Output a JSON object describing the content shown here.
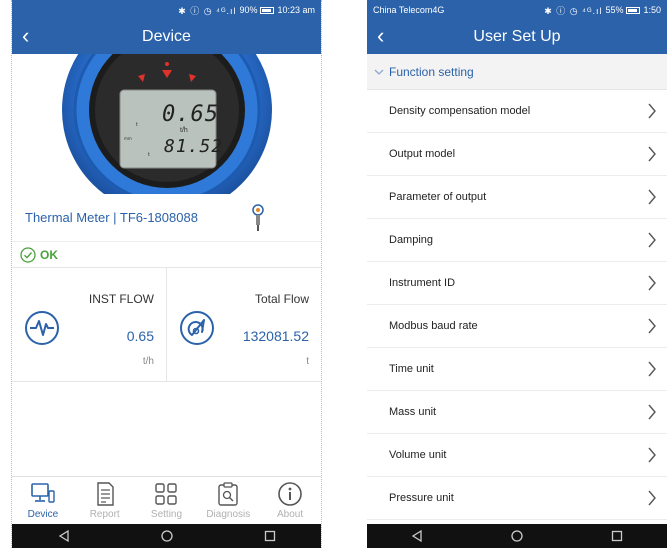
{
  "left": {
    "status": {
      "carrier": "",
      "icons": "✱ ⓘ ◷ ⁴ᴳ.ıl",
      "battery": "90%",
      "time": "10:23 am"
    },
    "header": {
      "title": "Device"
    },
    "display": {
      "primary": "0.65",
      "unit": "t/h",
      "secondary": "81.52"
    },
    "meter": {
      "name": "Thermal Meter  |  TF6-1808088"
    },
    "status_text": "OK",
    "inst_flow": {
      "label": "INST FLOW",
      "value": "0.65",
      "unit": "t/h"
    },
    "total_flow": {
      "label": "Total Flow",
      "value": "132081.52",
      "unit": "t"
    },
    "tabs": [
      {
        "label": "Device",
        "icon": "monitor-icon",
        "active": true
      },
      {
        "label": "Report",
        "icon": "document-icon",
        "active": false
      },
      {
        "label": "Setting",
        "icon": "grid-icon",
        "active": false
      },
      {
        "label": "Diagnosis",
        "icon": "clipboard-search-icon",
        "active": false
      },
      {
        "label": "About",
        "icon": "info-icon",
        "active": false
      }
    ]
  },
  "right": {
    "status": {
      "carrier": "China Telecom4G",
      "icons": "✱ ⓘ ◷ ⁴ᴳ.ıl",
      "battery": "55%",
      "time": "1:50"
    },
    "header": {
      "title": "User Set Up"
    },
    "section": {
      "title": "Function setting"
    },
    "menu": [
      "Density compensation model",
      "Output model",
      "Parameter of output",
      "Damping",
      "Instrument ID",
      "Modbus baud rate",
      "Time unit",
      "Mass unit",
      "Volume unit",
      "Pressure unit"
    ]
  },
  "colors": {
    "brand": "#2b62aa",
    "ok": "#4aa23c",
    "tab_inactive": "#b0b0b0"
  }
}
